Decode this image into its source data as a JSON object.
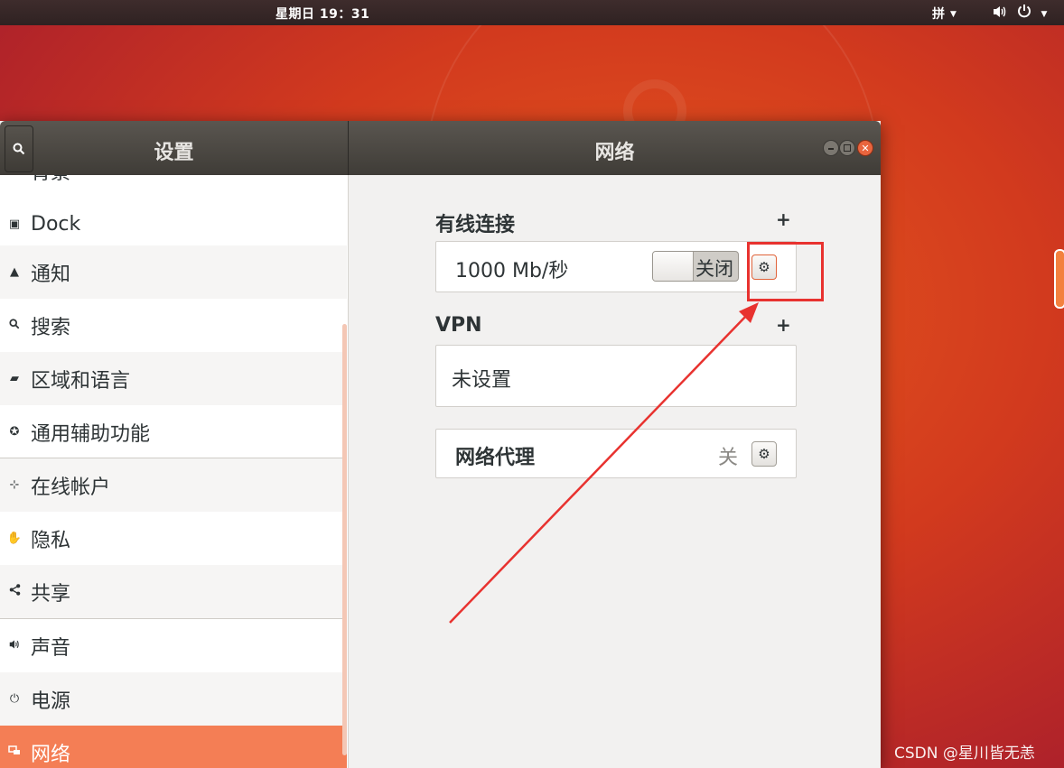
{
  "topbar": {
    "clock": "星期日 19：31",
    "input_method": "拼"
  },
  "window": {
    "sidebar_title": "设置",
    "content_title": "网络"
  },
  "sidebar": {
    "items": [
      {
        "label": "背景",
        "icon": "background-icon"
      },
      {
        "label": "Dock",
        "icon": "dock-icon"
      },
      {
        "label": "通知",
        "icon": "bell-icon"
      },
      {
        "label": "搜索",
        "icon": "search-icon"
      },
      {
        "label": "区域和语言",
        "icon": "region-icon"
      },
      {
        "label": "通用辅助功能",
        "icon": "accessibility-icon"
      },
      {
        "label": "在线帐户",
        "icon": "online-accounts-icon"
      },
      {
        "label": "隐私",
        "icon": "privacy-hand-icon"
      },
      {
        "label": "共享",
        "icon": "share-icon"
      },
      {
        "label": "声音",
        "icon": "sound-icon"
      },
      {
        "label": "电源",
        "icon": "power-plug-icon"
      },
      {
        "label": "网络",
        "icon": "network-icon",
        "active": true
      }
    ]
  },
  "network": {
    "wired": {
      "title": "有线连接",
      "speed": "1000 Mb/秒",
      "toggle_label": "关闭"
    },
    "vpn": {
      "title": "VPN",
      "status": "未设置"
    },
    "proxy": {
      "title": "网络代理",
      "status": "关"
    }
  },
  "watermark": "CSDN @星川皆无恙",
  "colors": {
    "accent": "#f47e55",
    "annotation": "#e8322f"
  }
}
